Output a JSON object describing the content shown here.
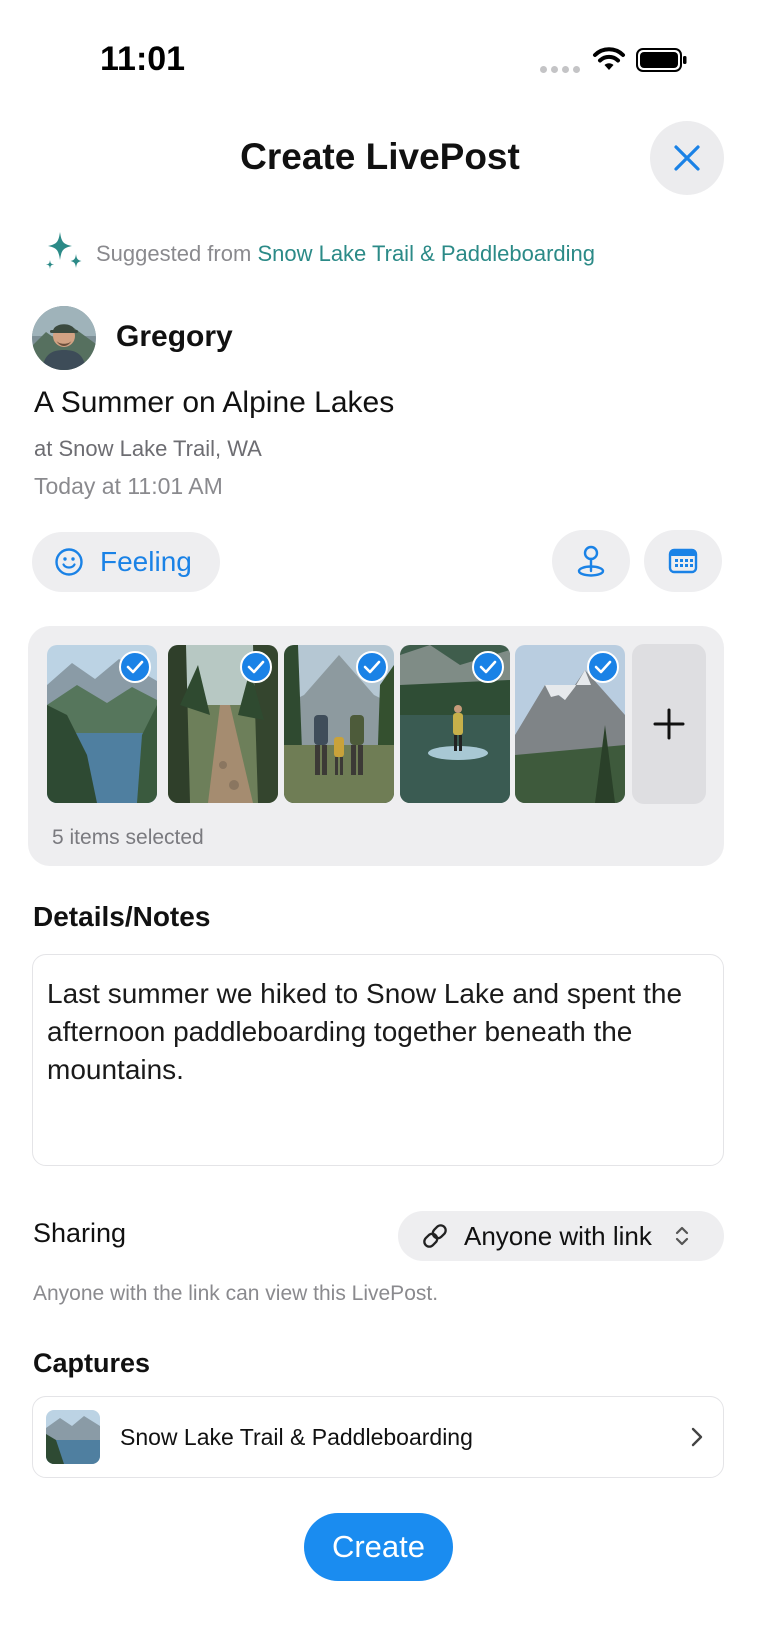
{
  "status_bar": {
    "time": "11:01"
  },
  "header": {
    "title": "Create LivePost",
    "close_icon": "close-icon"
  },
  "suggestion": {
    "prefix": "Suggested from",
    "source": "Snow Lake Trail & Paddleboarding",
    "icon": "sparkle-icon"
  },
  "author": {
    "name": "Gregory"
  },
  "post": {
    "title": "A Summer on Alpine Lakes",
    "location": "at Snow Lake Trail, WA",
    "timestamp": "Today at 11:01 AM"
  },
  "actions": {
    "feeling_label": "Feeling",
    "feeling_icon": "smiley-icon",
    "location_icon": "location-pin-icon",
    "calendar_icon": "calendar-icon"
  },
  "photos": {
    "items": [
      {
        "name": "alpine-lake",
        "selected": true
      },
      {
        "name": "forest-trail",
        "selected": true
      },
      {
        "name": "family-hike",
        "selected": true
      },
      {
        "name": "paddleboard",
        "selected": true
      },
      {
        "name": "mountain-peak",
        "selected": true
      }
    ],
    "selected_count": "5 items selected",
    "add_icon": "plus-icon"
  },
  "details": {
    "heading": "Details/Notes",
    "text": "Last summer we hiked to Snow Lake and spent the afternoon paddleboarding together beneath the mountains."
  },
  "sharing": {
    "label": "Sharing",
    "value": "Anyone with link",
    "hint": "Anyone with the link can view this LivePost."
  },
  "captures": {
    "heading": "Captures",
    "items": [
      {
        "label": "Snow Lake Trail & Paddleboarding"
      }
    ]
  },
  "create_button": {
    "label": "Create"
  },
  "colors": {
    "accent": "#1a82e6",
    "teal": "#2b8a87",
    "chip_bg": "#eeeef0"
  }
}
